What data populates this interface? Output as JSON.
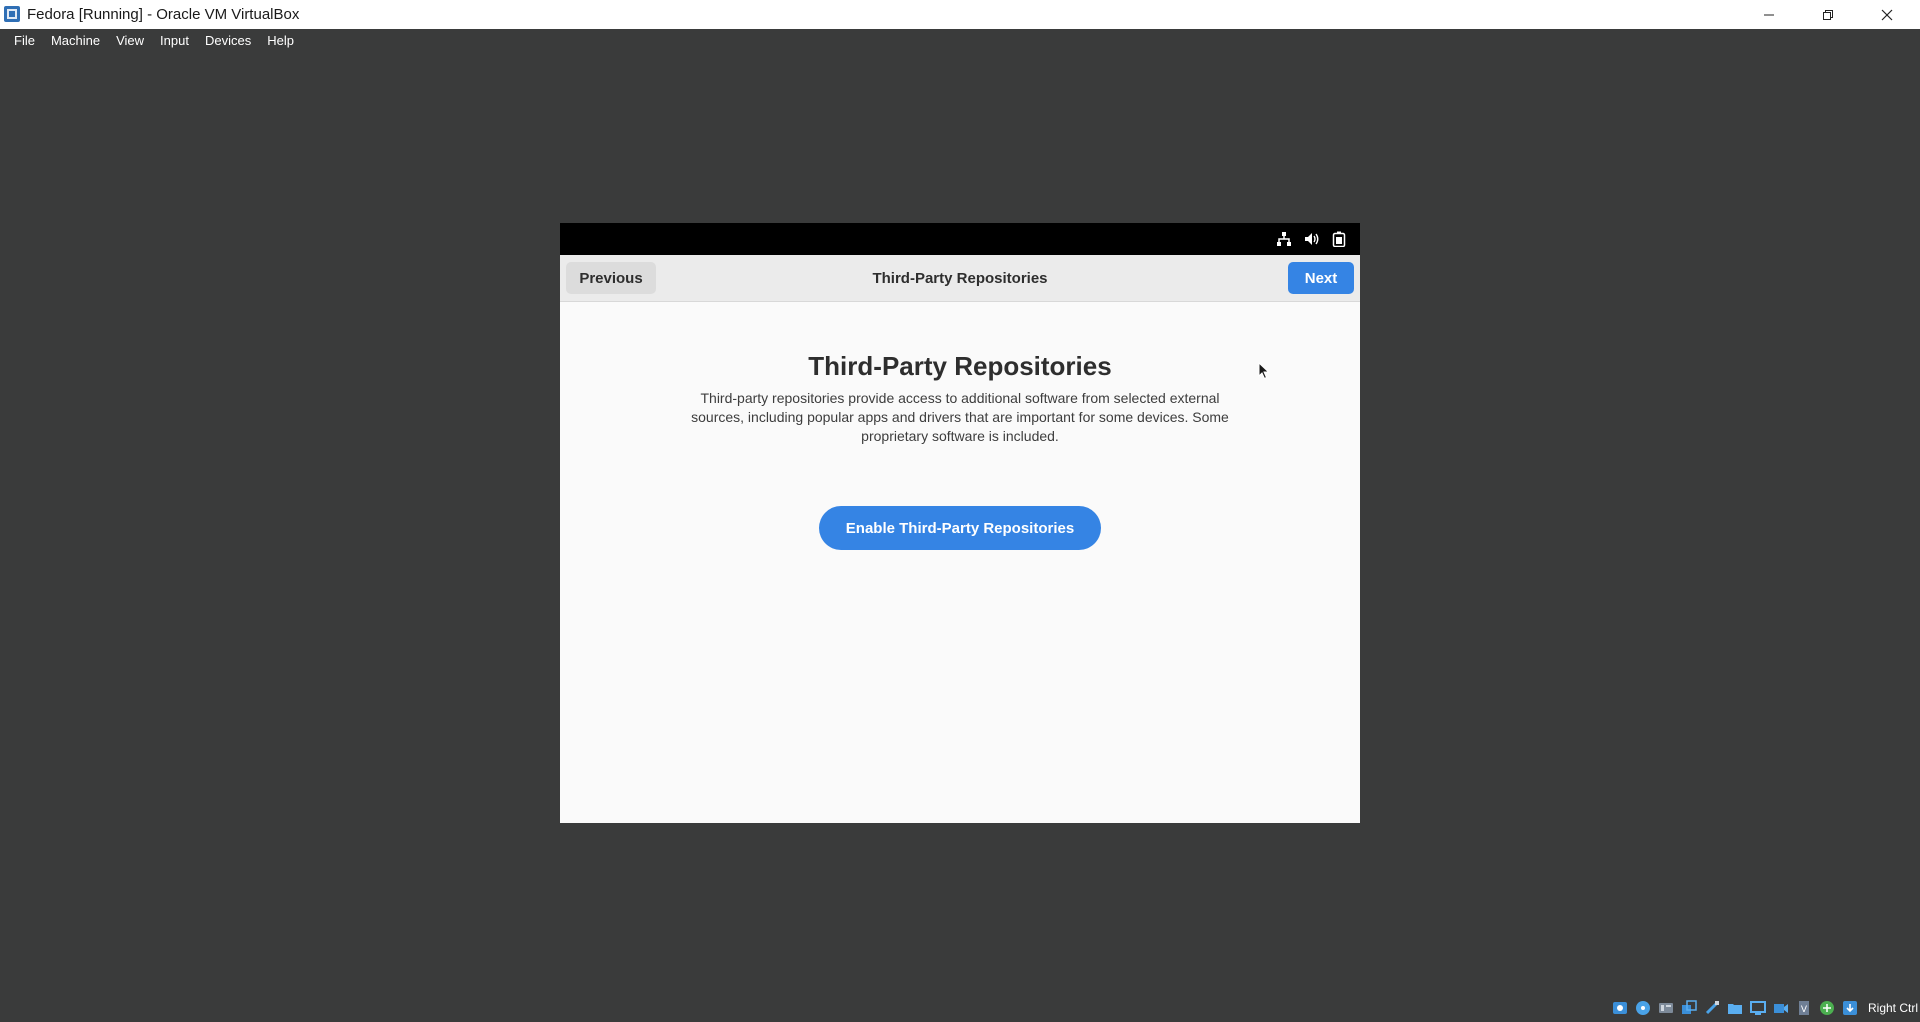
{
  "window": {
    "title": "Fedora [Running] - Oracle VM VirtualBox"
  },
  "menu": [
    "File",
    "Machine",
    "View",
    "Input",
    "Devices",
    "Help"
  ],
  "guest": {
    "header": {
      "previous_label": "Previous",
      "title": "Third-Party Repositories",
      "next_label": "Next"
    },
    "page": {
      "title": "Third-Party Repositories",
      "description": "Third-party repositories provide access to additional software from selected external sources, including popular apps and drivers that are important for some devices. Some proprietary software is included.",
      "enable_button": "Enable Third-Party Repositories"
    },
    "tray_icons": [
      "network-icon",
      "volume-icon",
      "battery-icon"
    ]
  },
  "statusbar": {
    "icons": [
      "hard-disk-icon",
      "optical-drive-icon",
      "audio-icon",
      "network-adapter-icon",
      "usb-icon",
      "shared-folder-icon",
      "display-icon",
      "recording-icon",
      "cpu-icon",
      "mouse-integration-icon",
      "keyboard-icon"
    ],
    "host_key": "Right Ctrl"
  },
  "colors": {
    "accent": "#3584e4",
    "host_background": "#3a3b3b",
    "guest_topbar": "#000000"
  }
}
